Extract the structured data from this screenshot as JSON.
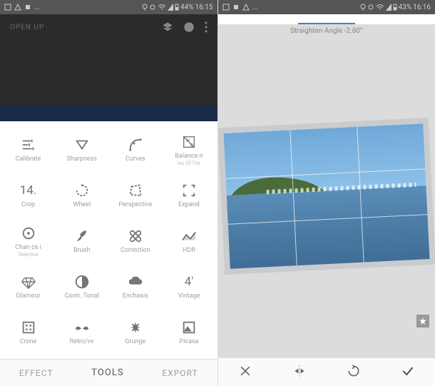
{
  "status_left": {
    "battery_pct": "44%",
    "time": "16:15",
    "ellipsis": "..."
  },
  "status_right": {
    "battery_pct": "43%",
    "time": "16:16",
    "ellipsis": "..."
  },
  "left_screen": {
    "header_title": "OPEN UP",
    "tools": [
      {
        "label": "Calibrate"
      },
      {
        "label": "Sharpness"
      },
      {
        "label": "Curves"
      },
      {
        "label": "Balance n",
        "sublabel": "Ino Of The"
      },
      {
        "label": "Crop",
        "text_icon": "14"
      },
      {
        "label": "Wheel"
      },
      {
        "label": "Perspective"
      },
      {
        "label": "Expand"
      },
      {
        "label": "Chan ce i",
        "sublabel": "Selective"
      },
      {
        "label": "Brush"
      },
      {
        "label": "Correction"
      },
      {
        "label": "HDR"
      },
      {
        "label": "Glamour"
      },
      {
        "label": "Contr. Tonal"
      },
      {
        "label": "Enchasis"
      },
      {
        "label": "Vintage",
        "text_icon": "4"
      },
      {
        "label": "Crone"
      },
      {
        "label": "Retro/vv"
      },
      {
        "label": "Grunge"
      },
      {
        "label": "Picasa"
      }
    ],
    "tabs": {
      "effect": "EFFECT",
      "tools": "TOOLS",
      "export": "EXPORT"
    }
  },
  "right_screen": {
    "angle_label": "Straighten Angle",
    "angle_value": "-2.80°",
    "actions": {
      "close": "Close",
      "flip": "Flip",
      "rotate": "Rotate",
      "confirm": "Confirm"
    }
  }
}
